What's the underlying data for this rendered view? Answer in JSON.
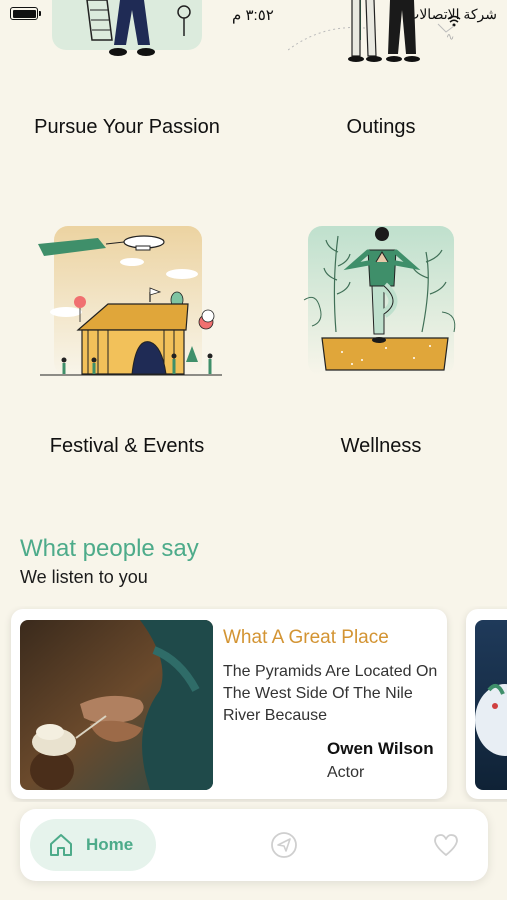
{
  "status_bar": {
    "carrier": "شركة الاتصالات",
    "time": "٣:٥٢ م"
  },
  "categories": [
    {
      "label": "Pursue Your Passion",
      "art": "runner-illustration"
    },
    {
      "label": "Outings",
      "art": "picnic-illustration"
    },
    {
      "label": "Festival & Events",
      "art": "circus-tent-illustration"
    },
    {
      "label": "Wellness",
      "art": "yoga-illustration"
    }
  ],
  "testimonials": {
    "title": "What people say",
    "subtitle": "We listen to you",
    "items": [
      {
        "title": "What A Great Place",
        "text": "The Pyramids Are Located On The West Side Of The Nile River Because",
        "name": "Owen Wilson",
        "role": "Actor"
      }
    ]
  },
  "nav": {
    "home_label": "Home",
    "items": [
      "home-icon",
      "send-icon",
      "heart-icon"
    ]
  },
  "colors": {
    "background": "#f8f5ea",
    "accent_green": "#4dab8a",
    "accent_gold": "#d39433"
  }
}
